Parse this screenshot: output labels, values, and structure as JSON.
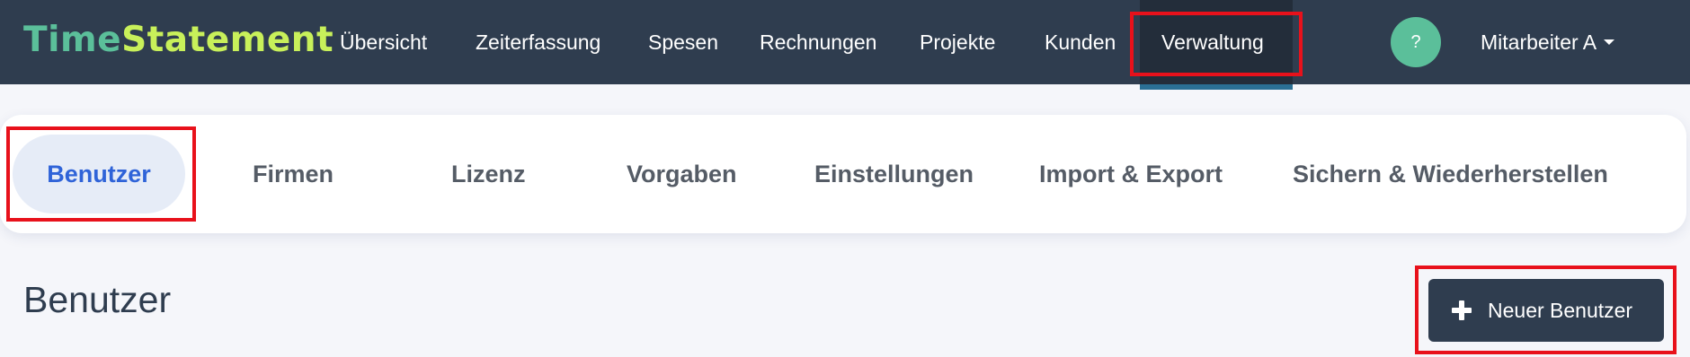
{
  "app": {
    "logo_part1": "Time",
    "logo_part2": "Statement",
    "colors": {
      "navbar": "#2f3d4f",
      "logo_time": "#5bbf9a",
      "logo_statement": "#c8f05a",
      "active_tab_text": "#2f63d8",
      "highlight": "#e8111b"
    }
  },
  "nav": {
    "items": [
      {
        "label": "Übersicht"
      },
      {
        "label": "Zeiterfassung"
      },
      {
        "label": "Spesen"
      },
      {
        "label": "Rechnungen"
      },
      {
        "label": "Projekte"
      },
      {
        "label": "Kunden"
      },
      {
        "label": "Verwaltung",
        "active": true
      }
    ],
    "help_label": "?",
    "help_icon": "question-icon",
    "user_label": "Mitarbeiter A",
    "user_icon": "caret-down-icon"
  },
  "tabs": {
    "items": [
      {
        "label": "Benutzer",
        "active": true
      },
      {
        "label": "Firmen"
      },
      {
        "label": "Lizenz"
      },
      {
        "label": "Vorgaben"
      },
      {
        "label": "Einstellungen"
      },
      {
        "label": "Import & Export"
      },
      {
        "label": "Sichern & Wiederherstellen"
      }
    ]
  },
  "page": {
    "title": "Benutzer",
    "new_button_label": "Neuer Benutzer",
    "new_button_icon": "plus-icon"
  }
}
